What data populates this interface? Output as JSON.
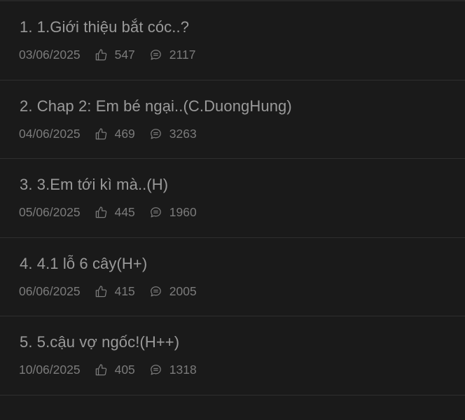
{
  "chapters": [
    {
      "title": "1. 1.Giới thiệu bắt cóc..?",
      "date": "03/06/2025",
      "likes": "547",
      "comments": "2117"
    },
    {
      "title": "2. Chap 2: Em bé ngại..(C.DuongHung)",
      "date": "04/06/2025",
      "likes": "469",
      "comments": "3263"
    },
    {
      "title": "3. 3.Em tới kì mà..(H)",
      "date": "05/06/2025",
      "likes": "445",
      "comments": "1960"
    },
    {
      "title": "4. 4.1 lỗ 6 cây(H+)",
      "date": "06/06/2025",
      "likes": "415",
      "comments": "2005"
    },
    {
      "title": "5. 5.cậu vợ ngốc!(H++)",
      "date": "10/06/2025",
      "likes": "405",
      "comments": "1318"
    }
  ],
  "icons": {
    "like": "thumbs-up-icon",
    "comment": "comment-icon"
  },
  "colors": {
    "background": "#1a1a1a",
    "title": "#9a9a9a",
    "meta": "#7b7b7b",
    "divider": "#2e2e2e"
  }
}
